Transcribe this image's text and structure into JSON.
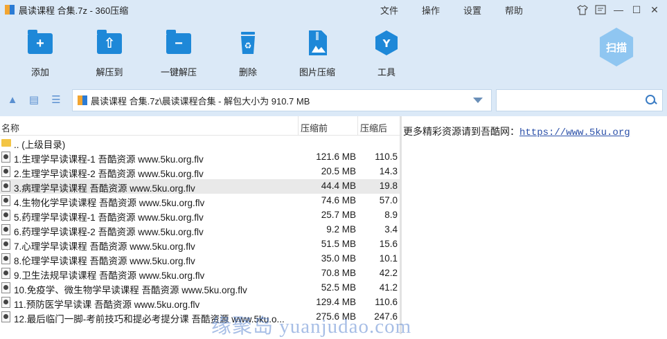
{
  "window": {
    "title": "晨读课程 合集.7z - 360压缩",
    "menu": [
      "文件",
      "操作",
      "设置",
      "帮助"
    ],
    "controls": {
      "skin": "shirt-icon",
      "feedback": "feedback-icon",
      "minimize": "—",
      "maximize": "☐",
      "close": "✕"
    }
  },
  "toolbar": {
    "items": [
      {
        "label": "添加",
        "icon": "add-icon"
      },
      {
        "label": "解压到",
        "icon": "extract-to-icon"
      },
      {
        "label": "一键解压",
        "icon": "one-click-extract-icon"
      },
      {
        "label": "删除",
        "icon": "delete-icon"
      },
      {
        "label": "图片压缩",
        "icon": "image-compress-icon"
      },
      {
        "label": "工具",
        "icon": "tools-icon"
      }
    ],
    "scan_label": "扫描"
  },
  "addressbar": {
    "path": "晨读课程 合集.7z\\晨读课程合集 - 解包大小为 910.7 MB"
  },
  "filelist": {
    "columns": {
      "name": "名称",
      "size": "压缩前",
      "packed": "压缩后"
    },
    "parent": ".. (上级目录)",
    "rows": [
      {
        "name": "1.生理学早读课程-1 吾酷资源 www.5ku.org.flv",
        "size": "121.6 MB",
        "packed": "110.5"
      },
      {
        "name": "2.生理学早读课程-2 吾酷资源 www.5ku.org.flv",
        "size": "20.5 MB",
        "packed": "14.3"
      },
      {
        "name": "3.病理学早读课程 吾酷资源 www.5ku.org.flv",
        "size": "44.4 MB",
        "packed": "19.8"
      },
      {
        "name": "4.生物化学早读课程 吾酷资源 www.5ku.org.flv",
        "size": "74.6 MB",
        "packed": "57.0"
      },
      {
        "name": "5.药理学早读课程-1 吾酷资源 www.5ku.org.flv",
        "size": "25.7 MB",
        "packed": "8.9"
      },
      {
        "name": "6.药理学早读课程-2 吾酷资源 www.5ku.org.flv",
        "size": "9.2 MB",
        "packed": "3.4"
      },
      {
        "name": "7.心理学早读课程 吾酷资源 www.5ku.org.flv",
        "size": "51.5 MB",
        "packed": "15.6"
      },
      {
        "name": "8.伦理学早读课程 吾酷资源 www.5ku.org.flv",
        "size": "35.0 MB",
        "packed": "10.1"
      },
      {
        "name": "9.卫生法规早读课程 吾酷资源 www.5ku.org.flv",
        "size": "70.8 MB",
        "packed": "42.2"
      },
      {
        "name": "10.免疫学、微生物学早读课程 吾酷资源 www.5ku.org.flv",
        "size": "52.5 MB",
        "packed": "41.2"
      },
      {
        "name": "11.预防医学早读课 吾酷资源 www.5ku.org.flv",
        "size": "129.4 MB",
        "packed": "110.6"
      },
      {
        "name": "12.最后临门一脚-考前技巧和提必考提分课 吾酷资源 www.5ku.o...",
        "size": "275.6 MB",
        "packed": "247.6"
      }
    ],
    "selected_index": 2
  },
  "infopane": {
    "text": "更多精彩资源请到吾酷网：",
    "link": "https://www.5ku.org"
  },
  "watermark": "缘聚岛 yuanjudao.com"
}
